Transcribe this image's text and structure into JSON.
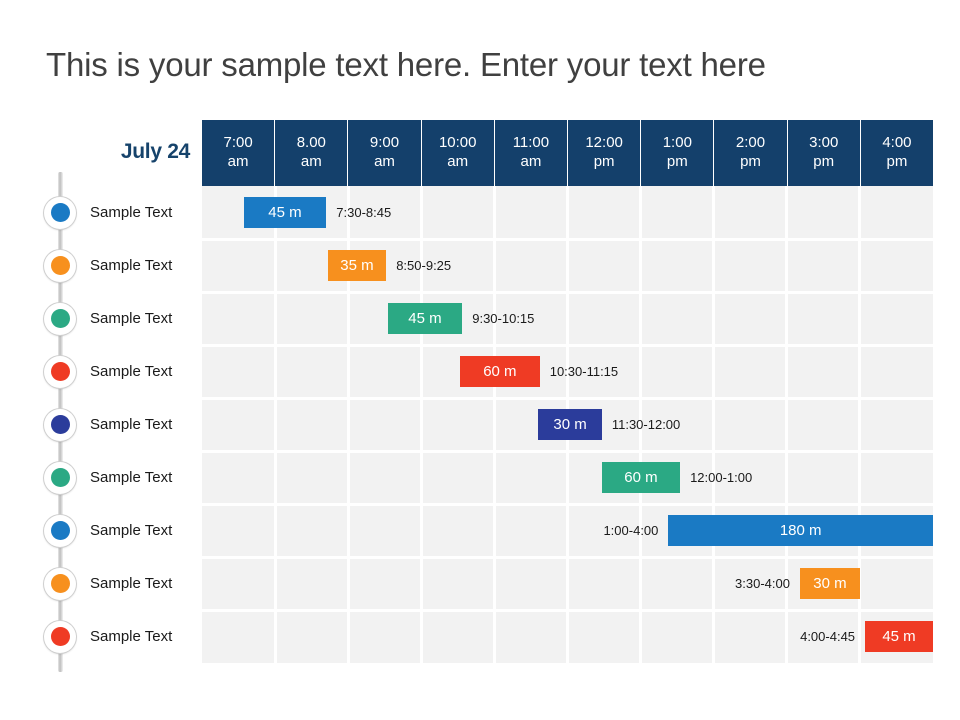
{
  "title": "This is your sample text here. Enter your text here",
  "date_label": "July 24",
  "colors": {
    "header_bg": "#14406b",
    "grid_bg": "#f2f2f2",
    "gridline": "#ffffff",
    "title_text": "#404040",
    "date_text": "#16436b",
    "blue": "#1a7ac4",
    "orange": "#f7901e",
    "green": "#2ba984",
    "red": "#ef3b24",
    "navy": "#2b3c9b"
  },
  "columns": [
    {
      "hour": "7:00",
      "meridiem": "am"
    },
    {
      "hour": "8.00",
      "meridiem": "am"
    },
    {
      "hour": "9:00",
      "meridiem": "am"
    },
    {
      "hour": "10:00",
      "meridiem": "am"
    },
    {
      "hour": "11:00",
      "meridiem": "am"
    },
    {
      "hour": "12:00",
      "meridiem": "pm"
    },
    {
      "hour": "1:00",
      "meridiem": "pm"
    },
    {
      "hour": "2:00",
      "meridiem": "pm"
    },
    {
      "hour": "3:00",
      "meridiem": "pm"
    },
    {
      "hour": "4:00",
      "meridiem": "pm"
    }
  ],
  "chart_data": {
    "type": "bar",
    "title": "This is your sample text here. Enter your text here",
    "xlabel": "",
    "ylabel": "",
    "grid": true,
    "legend": "none",
    "x_categories": [
      "7:00 am",
      "8.00 am",
      "9:00 am",
      "10:00 am",
      "11:00 am",
      "12:00 pm",
      "1:00 pm",
      "2:00 pm",
      "3:00 pm",
      "4:00 pm"
    ],
    "tasks": [
      {
        "label": "Sample Text",
        "duration": "45 m",
        "minutes": 45,
        "time_range": "7:30-8:45",
        "color": "#1a7ac4",
        "dot_color": "#1a7ac4",
        "start_col": 0.57,
        "end_col": 1.7,
        "note_side": "right"
      },
      {
        "label": "Sample Text",
        "duration": "35 m",
        "minutes": 35,
        "time_range": "8:50-9:25",
        "color": "#f7901e",
        "dot_color": "#f7901e",
        "start_col": 1.72,
        "end_col": 2.52,
        "note_side": "right"
      },
      {
        "label": "Sample Text",
        "duration": "45 m",
        "minutes": 45,
        "time_range": "9:30-10:15",
        "color": "#2ba984",
        "dot_color": "#2ba984",
        "start_col": 2.54,
        "end_col": 3.56,
        "note_side": "right"
      },
      {
        "label": "Sample Text",
        "duration": "60 m",
        "minutes": 60,
        "time_range": "10:30-11:15",
        "color": "#ef3b24",
        "dot_color": "#ef3b24",
        "start_col": 3.53,
        "end_col": 4.62,
        "note_side": "right"
      },
      {
        "label": "Sample Text",
        "duration": "30 m",
        "minutes": 30,
        "time_range": "11:30-12:00",
        "color": "#2b3c9b",
        "dot_color": "#2b3c9b",
        "start_col": 4.6,
        "end_col": 5.47,
        "note_side": "right"
      },
      {
        "label": "Sample Text",
        "duration": "60 m",
        "minutes": 60,
        "time_range": "12:00-1:00",
        "color": "#2ba984",
        "dot_color": "#2ba984",
        "start_col": 5.47,
        "end_col": 6.54,
        "note_side": "right"
      },
      {
        "label": "Sample Text",
        "duration": "180 m",
        "minutes": 180,
        "time_range": "1:00-4:00",
        "color": "#1a7ac4",
        "dot_color": "#1a7ac4",
        "start_col": 6.38,
        "end_col": 10.0,
        "note_side": "left"
      },
      {
        "label": "Sample Text",
        "duration": "30 m",
        "minutes": 30,
        "time_range": "3:30-4:00",
        "color": "#f7901e",
        "dot_color": "#f7901e",
        "start_col": 8.18,
        "end_col": 9.0,
        "note_side": "left"
      },
      {
        "label": "Sample Text",
        "duration": "45 m",
        "minutes": 45,
        "time_range": "4:00-4:45",
        "color": "#ef3b24",
        "dot_color": "#ef3b24",
        "start_col": 9.07,
        "end_col": 10.0,
        "note_side": "left"
      }
    ]
  }
}
